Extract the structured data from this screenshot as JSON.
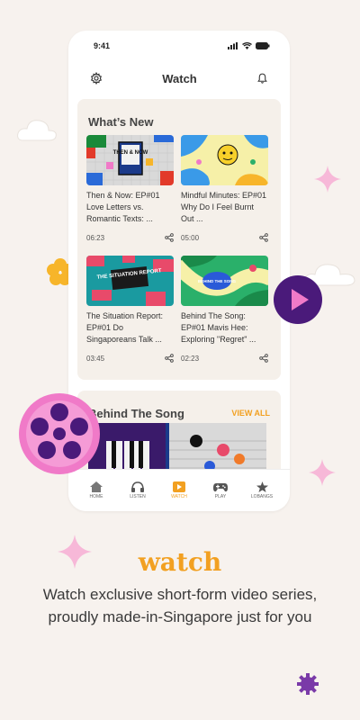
{
  "status_bar": {
    "time": "9:41"
  },
  "app_bar": {
    "title": "Watch",
    "left_icon": "gear-icon",
    "right_icon": "bell-icon"
  },
  "whats_new": {
    "title": "What’s New",
    "videos": [
      {
        "title": "Then & Now: EP#01 Love Letters vs. Romantic Texts: ...",
        "duration": "06:23",
        "thumb_label": "THEN & NOW"
      },
      {
        "title": "Mindful Minutes: EP#01 Why Do I Feel Burnt Out ...",
        "duration": "05:00",
        "thumb_label": ""
      },
      {
        "title": "The Situation Report: EP#01 Do Singaporeans Talk ...",
        "duration": "03:45",
        "thumb_label": "THE SITUATION REPORT"
      },
      {
        "title": "Behind The Song: EP#01 Mavis Hee: Exploring \"Regret\" ...",
        "duration": "02:23",
        "thumb_label": "BEHIND THE SONG"
      }
    ]
  },
  "behind_the_song": {
    "title": "Behind The Song",
    "view_all": "VIEW ALL"
  },
  "tab_bar": {
    "tabs": [
      {
        "label": "HOME",
        "icon": "home-icon"
      },
      {
        "label": "LISTEN",
        "icon": "headphones-icon"
      },
      {
        "label": "WATCH",
        "icon": "play-icon"
      },
      {
        "label": "PLAY",
        "icon": "gamepad-icon"
      },
      {
        "label": "LOBANGS",
        "icon": "star-icon"
      }
    ],
    "active": "WATCH"
  },
  "caption": {
    "headline": "watch",
    "body": "Watch exclusive short-form video series, proudly made-in-Singapore just for you"
  },
  "colors": {
    "accent": "#f2a021",
    "background": "#f7f2ee",
    "purple": "#4a1a7a",
    "pink": "#f07ac8"
  }
}
